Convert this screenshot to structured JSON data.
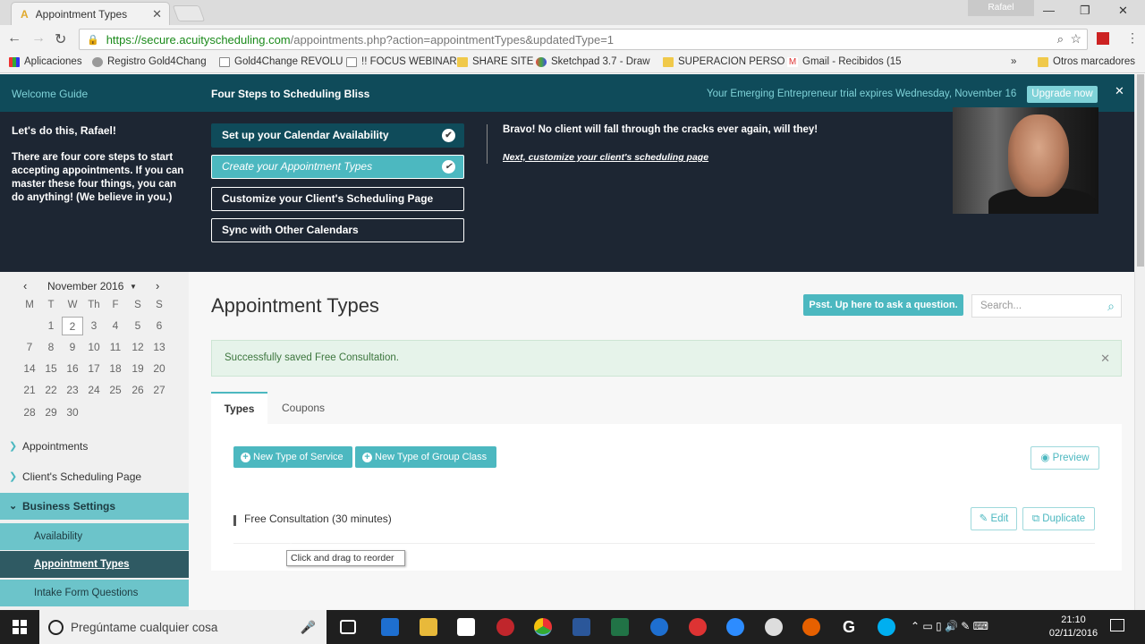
{
  "browser": {
    "tab_title": "Appointment Types",
    "profile_name": "Rafael",
    "url_host": "https://secure.acuityscheduling.com",
    "url_path": "/appointments.php?action=appointmentTypes&updatedType=1",
    "bookmarks": [
      "Aplicaciones",
      "Registro Gold4Chang",
      "Gold4Change REVOLU",
      "!! FOCUS WEBINAR",
      "SHARE SITE",
      "Sketchpad 3.7 - Draw",
      "SUPERACION PERSO",
      "Gmail - Recibidos (15",
      "»",
      "Otros marcadores"
    ]
  },
  "topnav": {
    "welcome_guide": "Welcome Guide",
    "four_steps": "Four Steps to Scheduling Bliss",
    "trial_text": "Your Emerging Entrepreneur trial expires Wednesday, November 16",
    "upgrade_label": "Upgrade now"
  },
  "guide": {
    "greeting": "Let's do this, Rafael!",
    "intro": "There are four core steps to start accepting appointments. If you can master these four things, you can do anything! (We believe in you.)",
    "steps": [
      "Set up your Calendar Availability",
      "Create your Appointment Types",
      "Customize your Client's Scheduling Page",
      "Sync with Other Calendars"
    ],
    "bravo": "Bravo! No client will fall through the cracks ever again, will they!",
    "next_link": "Next, customize your client's scheduling page"
  },
  "calendar": {
    "month": "November 2016",
    "weekdays": [
      "M",
      "T",
      "W",
      "Th",
      "F",
      "S",
      "S"
    ],
    "today": "2"
  },
  "sidebar": {
    "appointments": "Appointments",
    "client_page": "Client's Scheduling Page",
    "business_settings": "Business Settings",
    "availability": "Availability",
    "appointment_types": "Appointment Types",
    "intake": "Intake Form Questions"
  },
  "main": {
    "title": "Appointment Types",
    "psst": "Psst. Up here to ask a question.",
    "search_placeholder": "Search...",
    "alert": "Successfully saved Free Consultation.",
    "tab_types": "Types",
    "tab_coupons": "Coupons",
    "new_service": "New Type of Service",
    "new_group": "New Type of Group Class",
    "preview": "Preview",
    "service_name": "Free Consultation (30 minutes)",
    "edit": "Edit",
    "duplicate": "Duplicate",
    "tooltip": "Click and drag to reorder"
  },
  "taskbar": {
    "search_text": "Pregúntame cualquier cosa",
    "time": "21:10",
    "date": "02/11/2016"
  },
  "colors": {
    "teal": "#4cb8c0",
    "dark_teal": "#0f4b5a",
    "navy": "#1d2633"
  }
}
